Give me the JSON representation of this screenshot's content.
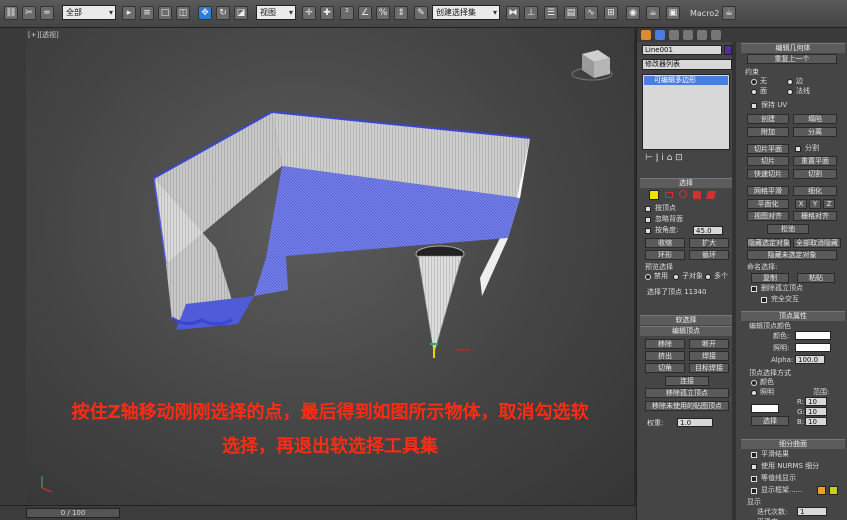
{
  "toolbar": {
    "selection_filter": "全部",
    "coord_system": "视图",
    "named_selection": "创建选择集",
    "macro_label": "Macro2"
  },
  "viewport": {
    "label": "[+][透视]",
    "timeline": "0 / 100"
  },
  "overlay": {
    "line1": "按住Z轴移动刚刚选择的点，最后得到如图所示物体，取消勾选软",
    "line2": "选择，再退出软选择工具集"
  },
  "left_panel": {
    "object_name": "Line001",
    "modifier_list": "修改器列表",
    "stack_item": "可编辑多边形",
    "selection_header": "选择",
    "by_vertex": "按顶点",
    "ignore_backfacing": "忽略背面",
    "by_angle": "按角度:",
    "angle_value": "45.0",
    "shrink": "收缩",
    "grow": "扩大",
    "ring": "环形",
    "loop": "循环",
    "preview_selection": "预览选择",
    "disabled": "禁用",
    "subobject": "子对象",
    "multi": "多个",
    "selected_info": "选择了顶点 11340",
    "soft_selection": "软选择",
    "edit_vertices": "编辑顶点",
    "remove": "移除",
    "break": "断开",
    "extrude": "挤出",
    "weld": "焊接",
    "chamfer": "切角",
    "target_weld": "目标焊接",
    "connect": "连接",
    "remove_isolated": "移除孤立顶点",
    "remove_unused_map": "移除未使用的贴图顶点",
    "weight_label": "权重:",
    "weight_value": "1.0"
  },
  "right_panel": {
    "edit_geometry": "编辑几何体",
    "repeat_last": "重复上一个",
    "constraints": "约束",
    "none": "无",
    "edge": "边",
    "face": "面",
    "normal": "法线",
    "preserve_uv": "保持 UV",
    "create": "创建",
    "collapse": "塌陷",
    "attach": "附加",
    "detach": "分离",
    "slice_plane": "切片平面",
    "split": "分割",
    "slice": "切片",
    "reset_plane": "重置平面",
    "quickslice": "快速切片",
    "cut": "切割",
    "meshsmooth": "网格平滑",
    "tessellate": "细化",
    "planarize": "平面化",
    "x": "X",
    "y": "Y",
    "z": "Z",
    "view_align": "视图对齐",
    "grid_align": "栅格对齐",
    "relax": "松弛",
    "hide_selected": "隐藏选定对象",
    "unhide_all": "全部取消隐藏",
    "hide_unselected": "隐藏未选定对象",
    "named_sel": "命名选择:",
    "copy": "复制",
    "paste": "粘贴",
    "delete_isolated": "删除孤立顶点",
    "full_interactivity": "完全交互",
    "vertex_props": "顶点属性",
    "edit_vertex_color": "编辑顶点颜色",
    "color": "颜色:",
    "illumination": "照明:",
    "alpha_label": "Alpha:",
    "alpha_value": "100.0",
    "select_by_vertex": "顶点选择方式",
    "opt_color": "颜色",
    "opt_illum": "照明",
    "range": "范围:",
    "r": "R:",
    "g": "G:",
    "b": "B:",
    "rgb_value": "10",
    "select": "选择",
    "subdiv_surface": "细分曲面",
    "smooth_result": "平滑结果",
    "use_nurms": "使用 NURMS 细分",
    "isoline_display": "等值线显示",
    "show_cage": "显示框架......",
    "display": "显示",
    "iterations": "迭代次数:",
    "iterations_value": "1",
    "smoothness": "平滑度:"
  },
  "colors": {
    "accent_blue": "#4b7ee0",
    "overlay_red": "#ff2b12",
    "stack_purple": "#5a2b9a"
  }
}
